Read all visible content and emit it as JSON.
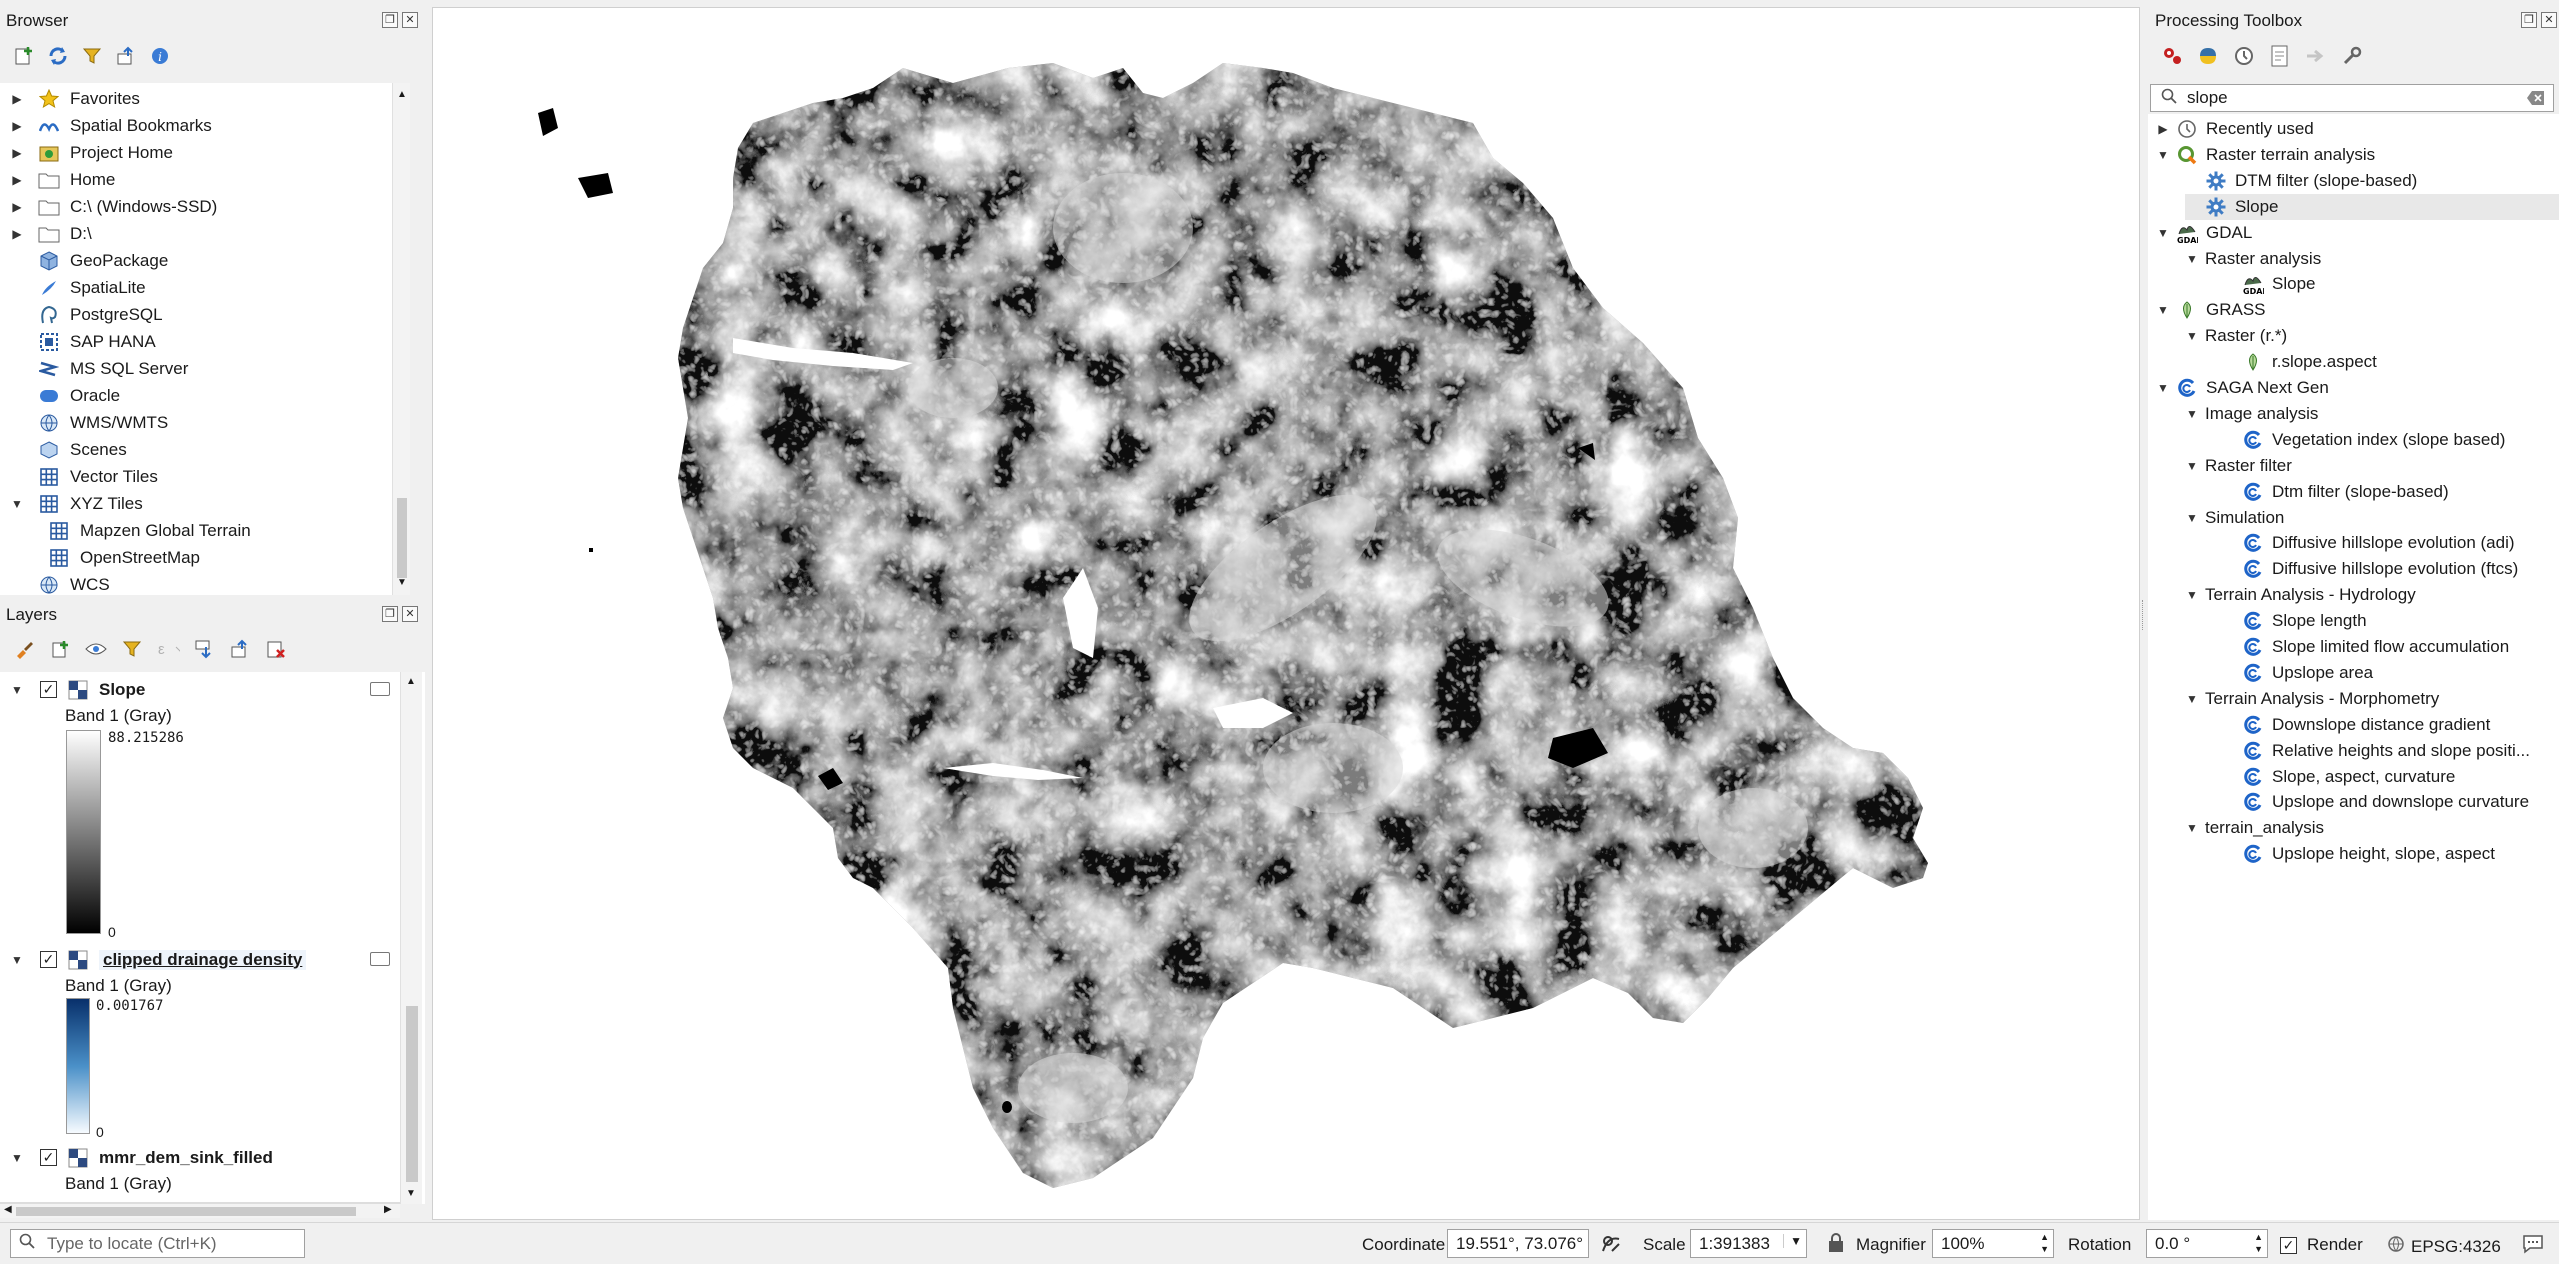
{
  "browser": {
    "title": "Browser",
    "items": [
      {
        "label": "Favorites",
        "icon": "star-icon"
      },
      {
        "label": "Spatial Bookmarks",
        "icon": "bookmarks-icon"
      },
      {
        "label": "Project Home",
        "icon": "project-home-icon"
      },
      {
        "label": "Home",
        "icon": "folder-icon"
      },
      {
        "label": "C:\\ (Windows-SSD)",
        "icon": "folder-icon"
      },
      {
        "label": "D:\\",
        "icon": "folder-icon"
      },
      {
        "label": "GeoPackage",
        "icon": "geopackage-icon"
      },
      {
        "label": "SpatiaLite",
        "icon": "spatialite-icon"
      },
      {
        "label": "PostgreSQL",
        "icon": "postgresql-icon"
      },
      {
        "label": "SAP HANA",
        "icon": "sap-hana-icon"
      },
      {
        "label": "MS SQL Server",
        "icon": "mssql-icon"
      },
      {
        "label": "Oracle",
        "icon": "oracle-icon"
      },
      {
        "label": "WMS/WMTS",
        "icon": "globe-icon"
      },
      {
        "label": "Scenes",
        "icon": "scenes-icon"
      },
      {
        "label": "Vector Tiles",
        "icon": "grid-icon"
      },
      {
        "label": "XYZ Tiles",
        "icon": "grid-icon"
      },
      {
        "label": "Mapzen Global Terrain",
        "icon": "grid-icon"
      },
      {
        "label": "OpenStreetMap",
        "icon": "grid-icon"
      },
      {
        "label": "WCS",
        "icon": "globe-icon"
      }
    ]
  },
  "layers": {
    "title": "Layers",
    "items": [
      {
        "name": "Slope",
        "band": "Band 1 (Gray)",
        "max": "88.215286",
        "min": "0",
        "ramp_top": "#ffffff",
        "ramp_bottom": "#000000"
      },
      {
        "name": "clipped drainage density",
        "band": "Band 1 (Gray)",
        "max": "0.001767",
        "min": "0",
        "ramp_top": "#08306b",
        "ramp_bottom": "#f7fbff"
      },
      {
        "name": "mmr_dem_sink_filled",
        "band": "Band 1 (Gray)"
      }
    ]
  },
  "toolbox": {
    "title": "Processing Toolbox",
    "search_value": "slope",
    "tree": [
      {
        "label": "Recently used",
        "level": 0,
        "icon": "clock-icon"
      },
      {
        "label": "Raster terrain analysis",
        "level": 0,
        "icon": "qgis-icon"
      },
      {
        "label": "DTM filter (slope-based)",
        "level": 1,
        "icon": "gear-icon"
      },
      {
        "label": "Slope",
        "level": 1,
        "icon": "gear-icon"
      },
      {
        "label": "GDAL",
        "level": 0,
        "icon": "gdal-icon"
      },
      {
        "label": "Raster analysis",
        "level": 1,
        "icon": ""
      },
      {
        "label": "Slope",
        "level": 2,
        "icon": "gdal-icon"
      },
      {
        "label": "GRASS",
        "level": 0,
        "icon": "grass-icon"
      },
      {
        "label": "Raster (r.*)",
        "level": 1,
        "icon": ""
      },
      {
        "label": "r.slope.aspect",
        "level": 2,
        "icon": "grass-icon"
      },
      {
        "label": "SAGA Next Gen",
        "level": 0,
        "icon": "saga-icon"
      },
      {
        "label": "Image analysis",
        "level": 1,
        "icon": ""
      },
      {
        "label": "Vegetation index (slope based)",
        "level": 2,
        "icon": "saga-icon"
      },
      {
        "label": "Raster filter",
        "level": 1,
        "icon": ""
      },
      {
        "label": "Dtm filter (slope-based)",
        "level": 2,
        "icon": "saga-icon"
      },
      {
        "label": "Simulation",
        "level": 1,
        "icon": ""
      },
      {
        "label": "Diffusive hillslope evolution (adi)",
        "level": 2,
        "icon": "saga-icon"
      },
      {
        "label": "Diffusive hillslope evolution (ftcs)",
        "level": 2,
        "icon": "saga-icon"
      },
      {
        "label": "Terrain Analysis - Hydrology",
        "level": 1,
        "icon": ""
      },
      {
        "label": "Slope length",
        "level": 2,
        "icon": "saga-icon"
      },
      {
        "label": "Slope limited flow accumulation",
        "level": 2,
        "icon": "saga-icon"
      },
      {
        "label": "Upslope area",
        "level": 2,
        "icon": "saga-icon"
      },
      {
        "label": "Terrain Analysis - Morphometry",
        "level": 1,
        "icon": ""
      },
      {
        "label": "Downslope distance gradient",
        "level": 2,
        "icon": "saga-icon"
      },
      {
        "label": "Relative heights and slope positi...",
        "level": 2,
        "icon": "saga-icon"
      },
      {
        "label": "Slope, aspect, curvature",
        "level": 2,
        "icon": "saga-icon"
      },
      {
        "label": "Upslope and downslope curvature",
        "level": 2,
        "icon": "saga-icon"
      },
      {
        "label": "terrain_analysis",
        "level": 1,
        "icon": ""
      },
      {
        "label": "Upslope height, slope, aspect",
        "level": 2,
        "icon": "saga-icon"
      }
    ]
  },
  "status": {
    "locate_placeholder": "Type to locate (Ctrl+K)",
    "coordinate_label": "Coordinate",
    "coordinate_value": "19.551°, 73.076°",
    "scale_label": "Scale",
    "scale_value": "1:391383",
    "magnifier_label": "Magnifier",
    "magnifier_value": "100%",
    "rotation_label": "Rotation",
    "rotation_value": "0.0 °",
    "render_label": "Render",
    "crs_label": "EPSG:4326"
  }
}
